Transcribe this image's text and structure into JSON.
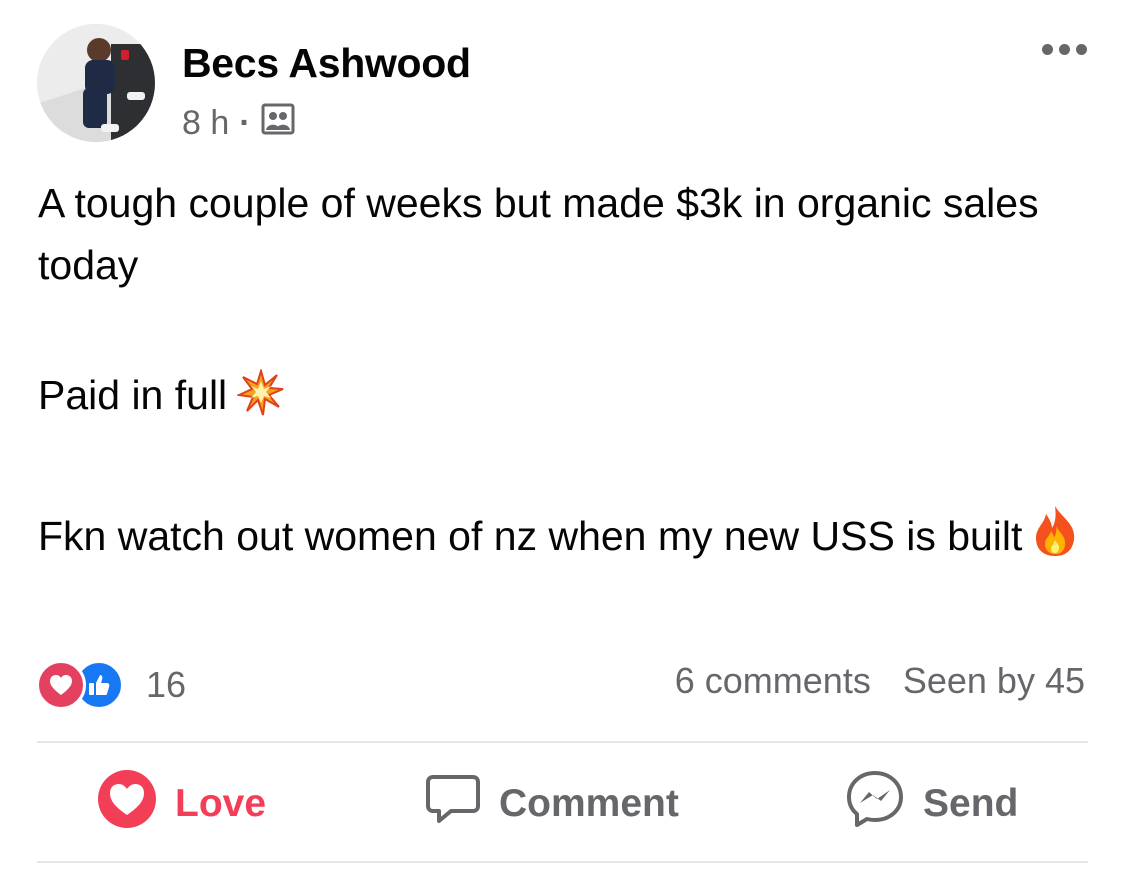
{
  "post": {
    "author": "Becs Ashwood",
    "time": "8 h",
    "separator": "·",
    "audience_icon": "group-icon",
    "more_icon": "more-options-icon",
    "lines": [
      "A tough couple of weeks but made $3k in organic sales today",
      "Paid in full",
      "Fkn watch out women of nz when my new USS is built"
    ],
    "emojis": [
      "collision-emoji",
      "fire-emoji"
    ]
  },
  "engagement": {
    "reaction_icons": [
      "love-reaction-icon",
      "like-reaction-icon"
    ],
    "reaction_count": "16",
    "comments": "6 comments",
    "seen_by": "Seen by 45"
  },
  "actions": {
    "love": "Love",
    "comment": "Comment",
    "send": "Send"
  },
  "colors": {
    "love": "#f33e58",
    "like": "#1877f2",
    "secondary_text": "#65676b",
    "divider": "#e4e6eb"
  }
}
